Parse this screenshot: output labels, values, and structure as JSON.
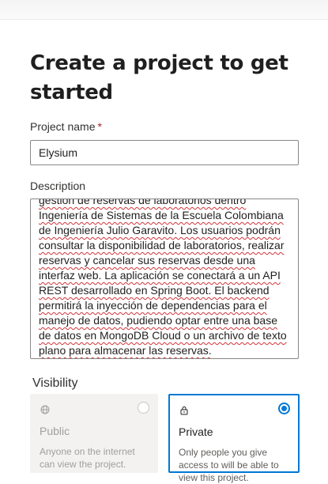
{
  "header": {
    "title": "Create a project to get started"
  },
  "form": {
    "project_name_label": "Project name",
    "required_marker": "*",
    "project_name_value": "Elysium",
    "description_label": "Description",
    "description_value": "gestión de reservas de laboratorios dentro Ingeniería de Sistemas de la Escuela Colombiana de Ingeniería Julio Garavito. Los usuarios podrán consultar la disponibilidad de laboratorios, realizar reservas y cancelar sus reservas desde una interfaz web. La aplicación se conectará a un API REST desarrollado en Spring Boot. El backend permitirá la inyección de dependencias para el manejo de datos, pudiendo optar entre una base de datos en MongoDB Cloud o un archivo de texto plano para almacenar las reservas."
  },
  "visibility": {
    "label": "Visibility",
    "options": [
      {
        "icon": "globe-icon",
        "title": "Public",
        "desc": "Anyone on the internet can view the project.",
        "selected": false,
        "disabled": true
      },
      {
        "icon": "lock-icon",
        "title": "Private",
        "desc": "Only people you give access to will be able to view this project.",
        "selected": true,
        "disabled": false
      }
    ]
  },
  "colors": {
    "accent": "#0078d4",
    "required": "#a4262c",
    "spellcheck": "#d13438"
  }
}
